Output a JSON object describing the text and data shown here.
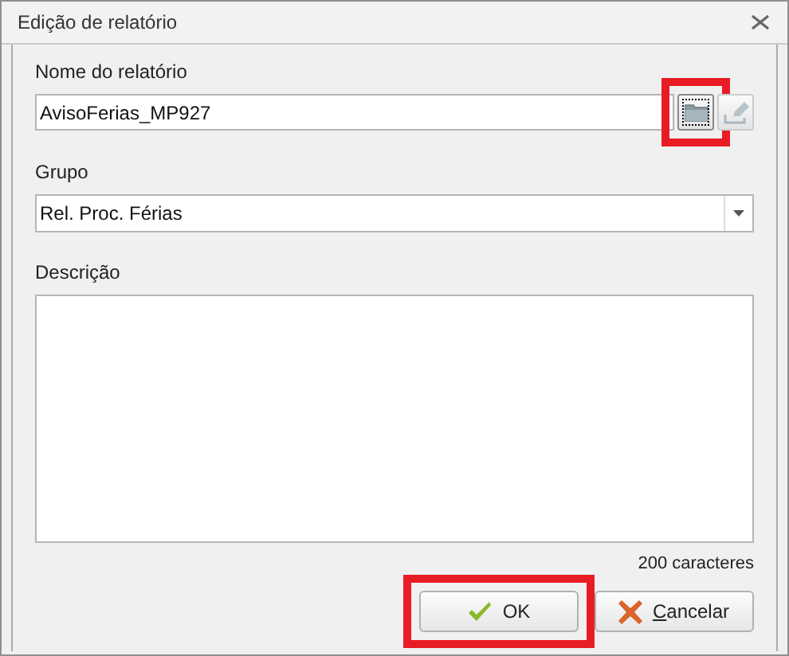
{
  "window": {
    "title": "Edição de relatório"
  },
  "name_field": {
    "label": "Nome do relatório",
    "value": "AvisoFerias_MP927"
  },
  "name_buttons": [
    {
      "kind": "folder",
      "highlighted": true,
      "focused": true
    },
    {
      "kind": "edit",
      "highlighted": false,
      "focused": false
    }
  ],
  "group_field": {
    "label": "Grupo",
    "value": "Rel. Proc. Férias"
  },
  "description_field": {
    "label": "Descrição",
    "counter": "200 caracteres"
  },
  "buttons": [
    {
      "kind": "ok",
      "label": "OK",
      "highlighted": true
    },
    {
      "kind": "cancel",
      "label": "Cancelar",
      "mnemonic_underlined": true,
      "highlighted": false
    }
  ]
}
